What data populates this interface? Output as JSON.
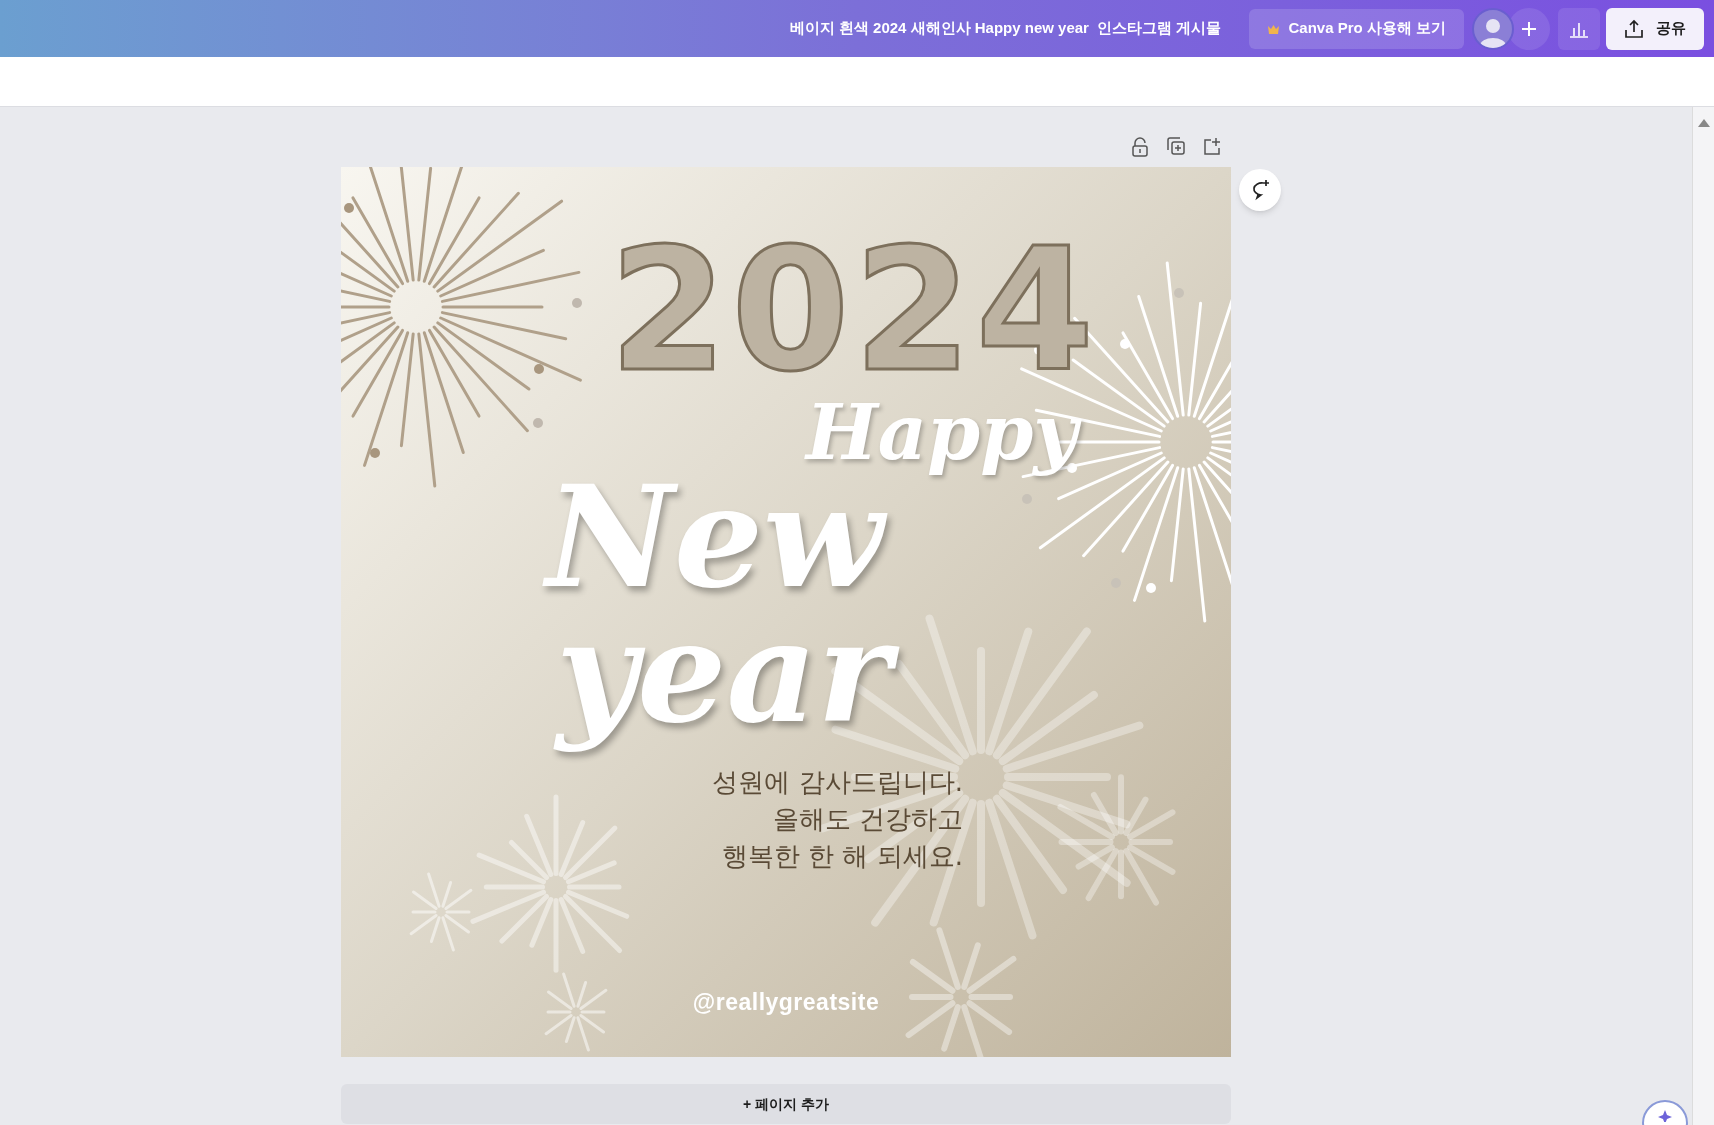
{
  "header": {
    "title": "베이지 흰색 2024 새해인사 Happy new year  인스타그램 게시물",
    "pro_button": "Canva Pro 사용해 보기",
    "share_button": "공유"
  },
  "design": {
    "year": "2024",
    "happy": "Happy",
    "new_word": "New",
    "year_word": "year",
    "message": [
      "성원에 감사드립니다.",
      "올해도 건강하고",
      "행복한 한 해 되세요."
    ],
    "handle": "@reallygreatsite"
  },
  "add_page": "+ 페이지 추가"
}
